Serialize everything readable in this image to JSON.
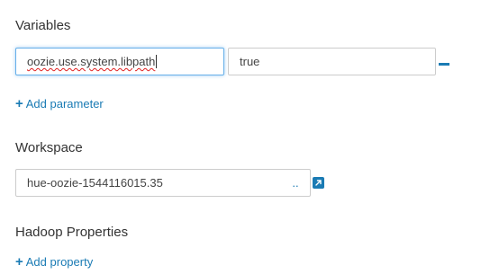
{
  "variables": {
    "title": "Variables",
    "name_value": "oozie.use.system.libpath",
    "value_value": "true",
    "add_label": "Add parameter"
  },
  "workspace": {
    "title": "Workspace",
    "path_value": "hue-oozie-1544116015.35",
    "browse_label": ".."
  },
  "hadoop": {
    "title": "Hadoop Properties",
    "add_label": "Add property"
  },
  "colors": {
    "link": "#1a7bb4",
    "focus_border": "#66afe9",
    "field_border": "#cccccc"
  },
  "icons": {
    "add": "plus-icon",
    "remove": "minus-icon",
    "open": "external-link-icon"
  }
}
